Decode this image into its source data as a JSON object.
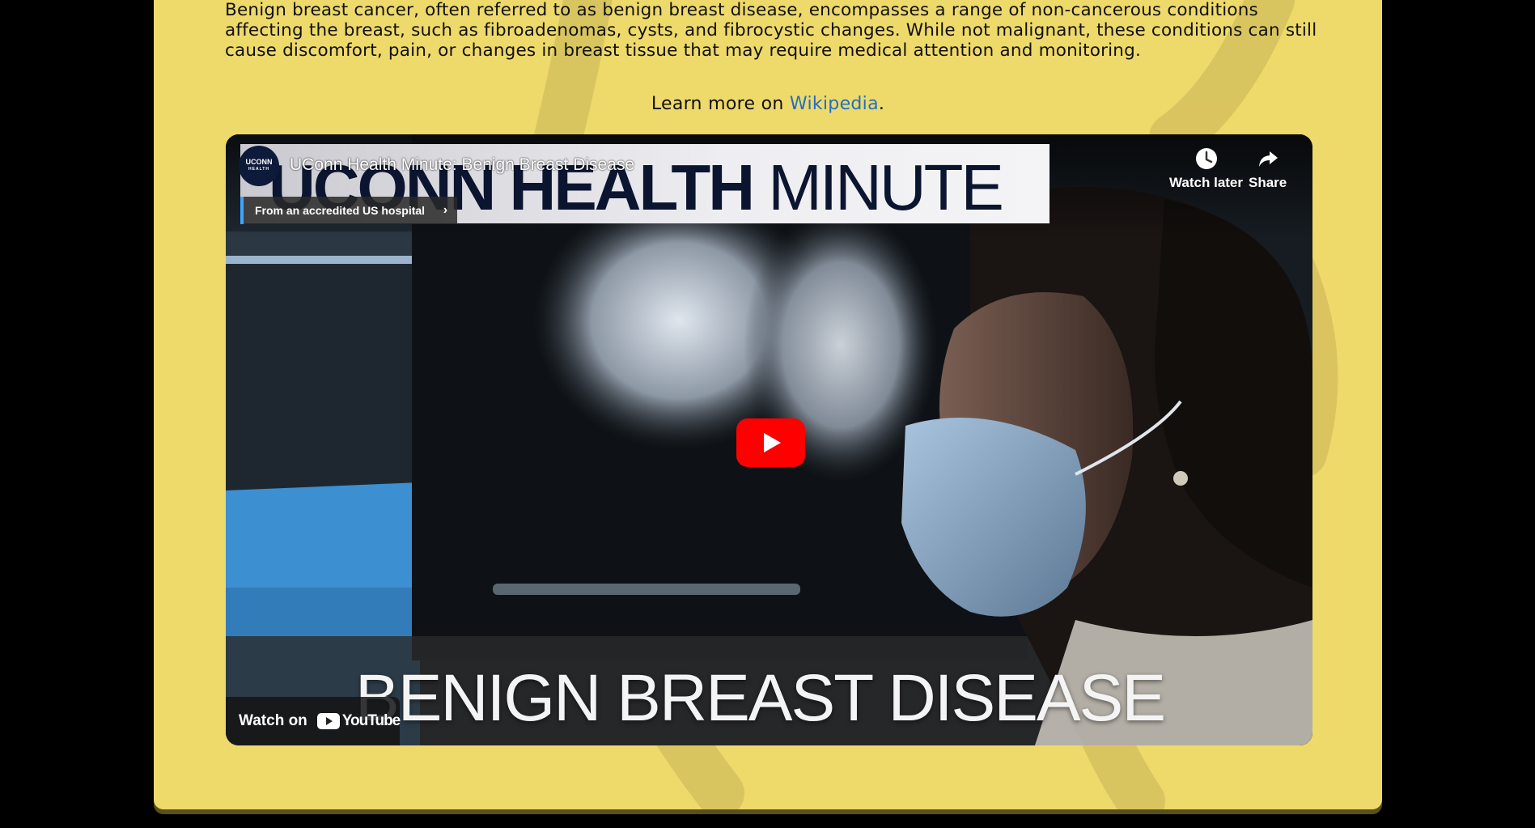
{
  "article": {
    "paragraph": "Benign breast cancer, often referred to as benign breast disease, encompasses a range of non-cancerous conditions affecting the breast, such as fibroadenomas, cysts, and fibrocystic changes. While not malignant, these conditions can still cause discomfort, pain, or changes in breast tissue that may require medical attention and monitoring.",
    "learn_more_prefix": "Learn more on ",
    "learn_more_link": "Wikipedia",
    "learn_more_suffix": "."
  },
  "video": {
    "title": "UConn Health Minute: Benign Breast Disease",
    "channel_logo_text": "UCONN",
    "channel_logo_sub": "HEALTH",
    "banner_bold": "UCONN HEALTH",
    "banner_light": "MINUTE",
    "accredited_label": "From an accredited US hospital",
    "watch_later_label": "Watch later",
    "share_label": "Share",
    "overlay_title": "BENIGN BREAST DISEASE",
    "watch_on_label": "Watch on",
    "youtube_label": "YouTube"
  },
  "colors": {
    "panel_bg": "#eed96b",
    "link": "#1f6fc7",
    "play_button": "#ff0000",
    "accredited_accent": "#3ea6ff"
  },
  "icons": [
    "clock-icon",
    "share-arrow-icon",
    "play-icon",
    "chevron-right-icon",
    "youtube-logo-icon"
  ]
}
